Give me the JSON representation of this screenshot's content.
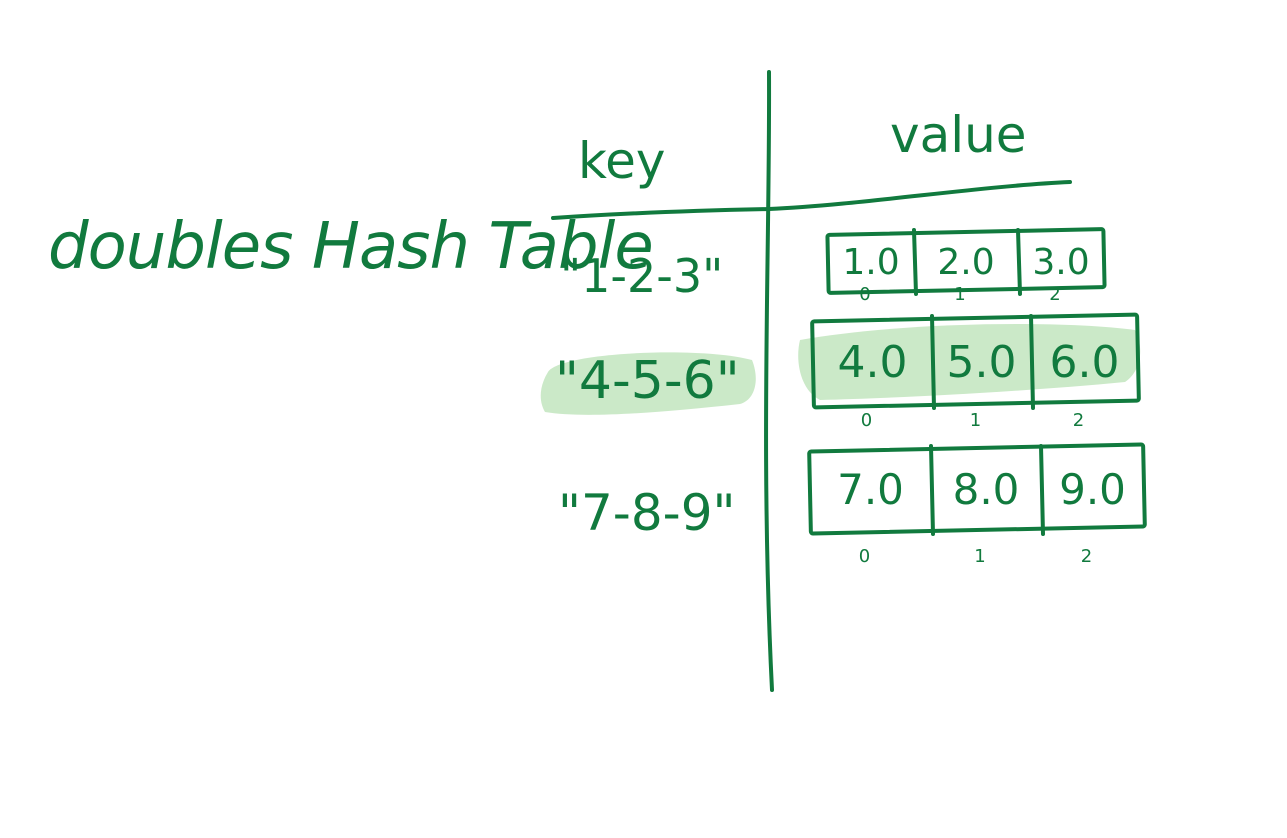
{
  "colors": {
    "ink": "#117a3e",
    "highlight": "#a9dba3"
  },
  "title": "doubles Hash Table",
  "headers": {
    "key": "key",
    "value": "value"
  },
  "rows": [
    {
      "key": "\"1-2-3\"",
      "values": [
        "1.0",
        "2.0",
        "3.0"
      ],
      "indices": [
        "0",
        "1",
        "2"
      ],
      "highlighted": false
    },
    {
      "key": "\"4-5-6\"",
      "values": [
        "4.0",
        "5.0",
        "6.0"
      ],
      "indices": [
        "0",
        "1",
        "2"
      ],
      "highlighted": true
    },
    {
      "key": "\"7-8-9\"",
      "values": [
        "7.0",
        "8.0",
        "9.0"
      ],
      "indices": [
        "0",
        "1",
        "2"
      ],
      "highlighted": false
    }
  ]
}
